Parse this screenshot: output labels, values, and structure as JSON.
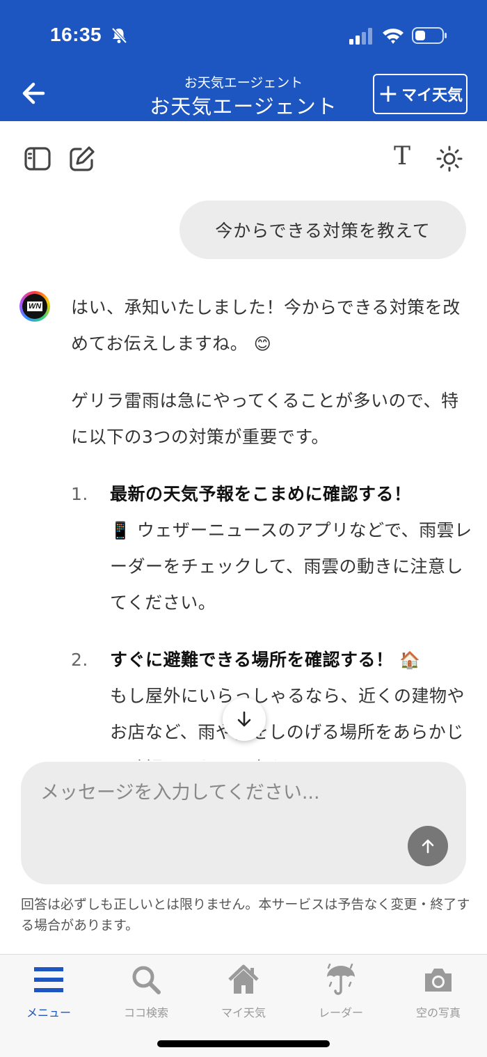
{
  "status_bar": {
    "time": "16:35"
  },
  "header": {
    "subtitle": "お天気エージェント",
    "title": "お天気エージェント",
    "my_weather_button": "マイ天気"
  },
  "toolbar": {
    "font_icon_glyph": "T"
  },
  "chat": {
    "user_message": "今からできる対策を教えて",
    "reply": {
      "intro": "はい、承知いたしました！今からできる対策を改めてお伝えしますね。",
      "intro_emoji": "😊",
      "para2": "ゲリラ雷雨は急にやってくることが多いので、特に以下の3つの対策が重要です。",
      "items": [
        {
          "num": "1.",
          "title": "最新の天気予報をこまめに確認する！",
          "emoji": "📱",
          "body": "ウェザーニュースのアプリなどで、雨雲レーダーをチェックして、雨雲の動きに注意してください。"
        },
        {
          "num": "2.",
          "title": "すぐに避難できる場所を確認する！",
          "emoji": "🏠",
          "body": "もし屋外にいらっしゃるなら、近くの建物やお店など、雨や雷をしのげる場所をあらかじめ確認しておくと安心です。"
        }
      ]
    }
  },
  "input": {
    "placeholder": "メッセージを入力してください..."
  },
  "disclaimer": "回答は必ずしも正しいとは限りません。本サービスは予告なく変更・終了する場合があります。",
  "bottom_nav": [
    {
      "label": "メニュー",
      "icon": "menu-icon",
      "active": true
    },
    {
      "label": "ココ検索",
      "icon": "search-icon",
      "active": false
    },
    {
      "label": "マイ天気",
      "icon": "home-icon",
      "active": false
    },
    {
      "label": "レーダー",
      "icon": "umbrella-icon",
      "active": false
    },
    {
      "label": "空の写真",
      "icon": "camera-icon",
      "active": false
    }
  ],
  "colors": {
    "brand_blue": "#1d56c1",
    "bubble_gray": "#ececec",
    "nav_inactive": "#999999"
  }
}
